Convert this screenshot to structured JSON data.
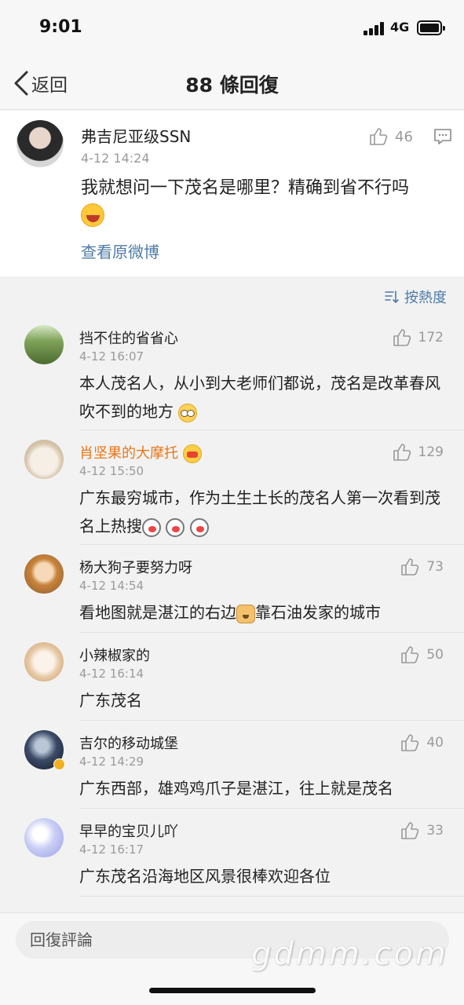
{
  "status_bar": {
    "time": "9:01",
    "network": "4G"
  },
  "nav": {
    "back_label": "返回",
    "title": "88 條回復"
  },
  "original": {
    "user": "弗吉尼亚级SSN",
    "time": "4-12 14:24",
    "text": "我就想问一下茂名是哪里？精确到省不行吗",
    "emoji": "laughing-emoji",
    "likes": "46",
    "view_original_label": "查看原微博"
  },
  "sort": {
    "label": "按熱度"
  },
  "comments": [
    {
      "user": "挡不住的省省心",
      "time": "4-12 16:07",
      "text": "本人茂名人，从小到大老师们都说，茂名是改革春风吹不到的地方",
      "emoji": "nerd-glasses-emoji",
      "likes": "172"
    },
    {
      "user": "肖坚果的大摩托",
      "time": "4-12 15:50",
      "text": "广东最穷城市，作为土生土长的茂名人第一次看到茂名上热搜",
      "emoji": "husky-emoji",
      "likes": "129",
      "vip": true
    },
    {
      "user": "杨大狗子要努力呀",
      "time": "4-12 14:54",
      "text_before": "看地图就是湛江的右边",
      "text_after": "靠石油发家的城市",
      "emoji": "doge-emoji",
      "likes": "73"
    },
    {
      "user": "小辣椒家的",
      "time": "4-12 16:14",
      "text": "广东茂名",
      "likes": "50"
    },
    {
      "user": "吉尔的移动城堡",
      "time": "4-12 14:29",
      "text": "广东西部，雄鸡鸡爪子是湛江，往上就是茂名",
      "likes": "40"
    },
    {
      "user": "早早的宝贝儿吖",
      "time": "4-12 16:17",
      "text": "广东茂名沿海地区风景很棒欢迎各位",
      "likes": "33"
    }
  ],
  "reply_bar": {
    "placeholder": "回復評論"
  },
  "watermark": "gdmm.com",
  "colors": {
    "link": "#4d7ba8",
    "vip_name": "#e8771a",
    "meta": "#9a9a9a"
  }
}
